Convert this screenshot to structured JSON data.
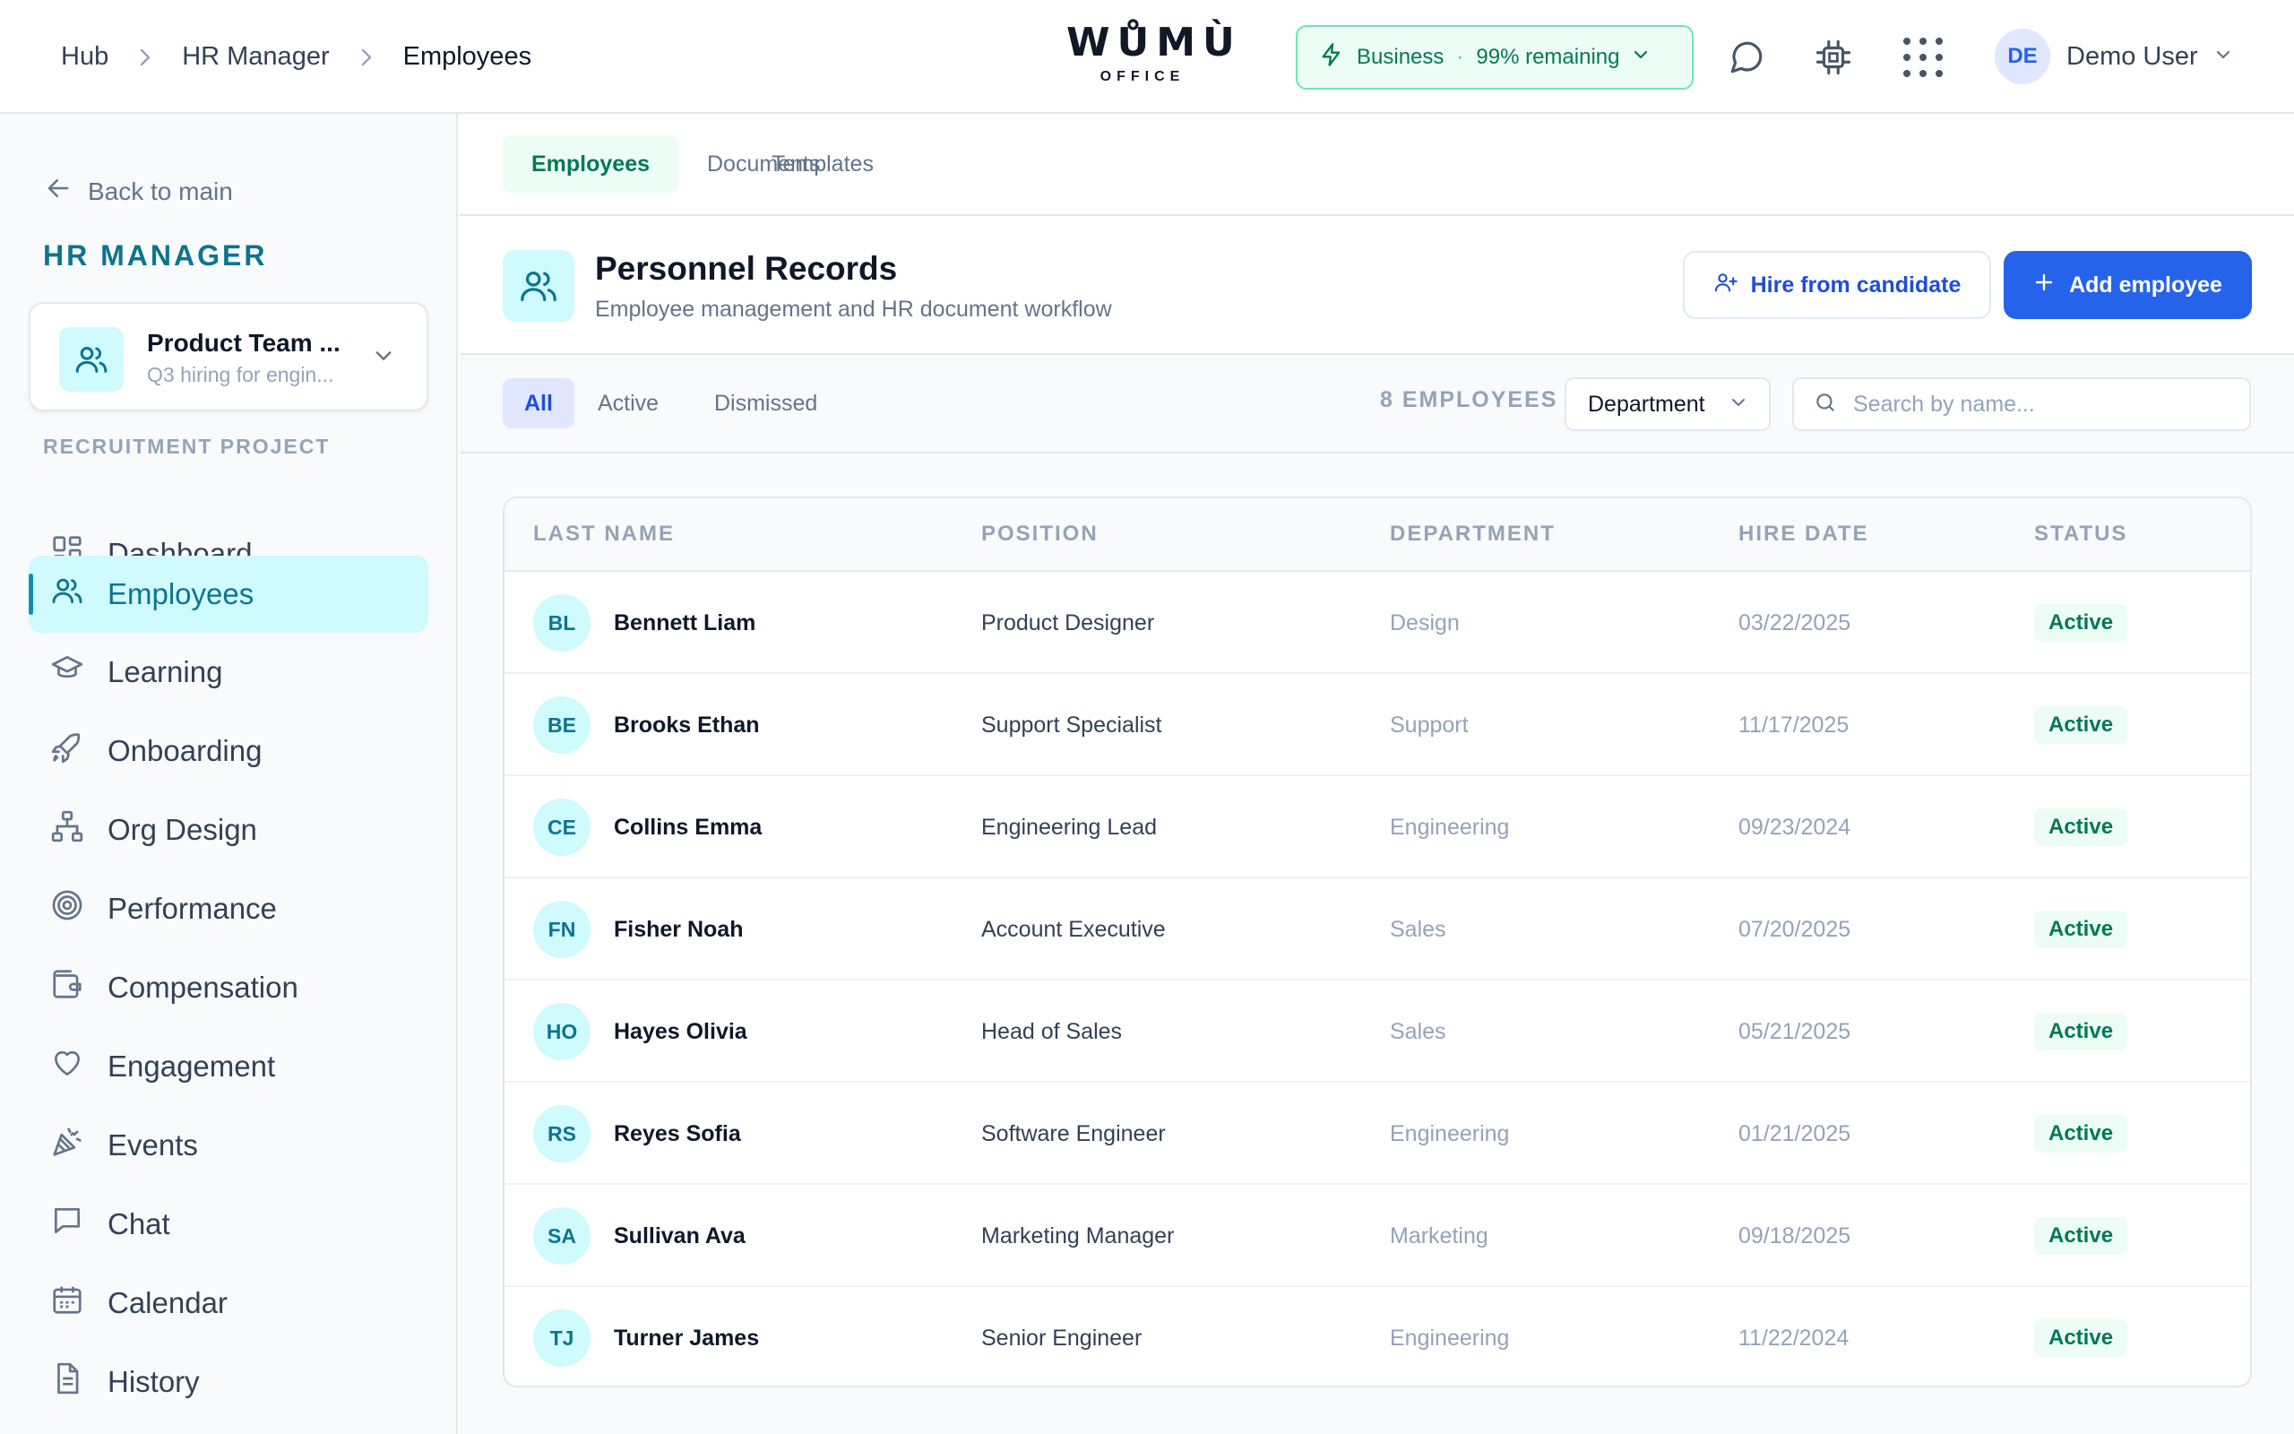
{
  "header": {
    "breadcrumb": [
      "Hub",
      "HR Manager",
      "Employees"
    ],
    "logo_mark": "WŮMÙ",
    "logo_sub": "OFFICE",
    "plan_name": "Business",
    "plan_dot": "·",
    "plan_remaining": "99% remaining",
    "user_initials": "DE",
    "user_name": "Demo User"
  },
  "sidebar": {
    "back_label": "Back to main",
    "title": "HR MANAGER",
    "project_name": "Product Team ...",
    "project_sub": "Q3 hiring for engin...",
    "section_label": "RECRUITMENT PROJECT",
    "items": [
      {
        "label": "Dashboard",
        "icon": "dashboard-icon"
      },
      {
        "label": "Employees",
        "icon": "users-icon",
        "active": true
      },
      {
        "label": "Learning",
        "icon": "graduation-cap-icon"
      },
      {
        "label": "Onboarding",
        "icon": "rocket-icon"
      },
      {
        "label": "Org Design",
        "icon": "org-chart-icon"
      },
      {
        "label": "Performance",
        "icon": "target-icon"
      },
      {
        "label": "Compensation",
        "icon": "wallet-icon"
      },
      {
        "label": "Engagement",
        "icon": "heart-icon"
      },
      {
        "label": "Events",
        "icon": "party-popper-icon"
      },
      {
        "label": "Chat",
        "icon": "chat-icon"
      },
      {
        "label": "Calendar",
        "icon": "calendar-icon"
      },
      {
        "label": "History",
        "icon": "document-icon"
      }
    ]
  },
  "tabs": [
    "Employees",
    "Documents",
    "Templates"
  ],
  "page": {
    "title": "Personnel Records",
    "subtitle": "Employee management and HR document workflow",
    "hire_button": "Hire from candidate",
    "add_button": "Add employee"
  },
  "filters": {
    "tabs": [
      "All",
      "Active",
      "Dismissed"
    ],
    "count": "8 EMPLOYEES",
    "department": "Department",
    "search_placeholder": "Search by name..."
  },
  "table": {
    "columns": [
      "LAST NAME",
      "POSITION",
      "DEPARTMENT",
      "HIRE DATE",
      "STATUS"
    ],
    "rows": [
      {
        "initials": "BL",
        "name": "Bennett Liam",
        "position": "Product Designer",
        "department": "Design",
        "hire_date": "03/22/2025",
        "status": "Active"
      },
      {
        "initials": "BE",
        "name": "Brooks Ethan",
        "position": "Support Specialist",
        "department": "Support",
        "hire_date": "11/17/2025",
        "status": "Active"
      },
      {
        "initials": "CE",
        "name": "Collins Emma",
        "position": "Engineering Lead",
        "department": "Engineering",
        "hire_date": "09/23/2024",
        "status": "Active"
      },
      {
        "initials": "FN",
        "name": "Fisher Noah",
        "position": "Account Executive",
        "department": "Sales",
        "hire_date": "07/20/2025",
        "status": "Active"
      },
      {
        "initials": "HO",
        "name": "Hayes Olivia",
        "position": "Head of Sales",
        "department": "Sales",
        "hire_date": "05/21/2025",
        "status": "Active"
      },
      {
        "initials": "RS",
        "name": "Reyes Sofia",
        "position": "Software Engineer",
        "department": "Engineering",
        "hire_date": "01/21/2025",
        "status": "Active"
      },
      {
        "initials": "SA",
        "name": "Sullivan Ava",
        "position": "Marketing Manager",
        "department": "Marketing",
        "hire_date": "09/18/2025",
        "status": "Active"
      },
      {
        "initials": "TJ",
        "name": "Turner James",
        "position": "Senior Engineer",
        "department": "Engineering",
        "hire_date": "11/22/2024",
        "status": "Active"
      }
    ]
  },
  "colors": {
    "accent": "#2563eb",
    "teal": "#0e7490",
    "success": "#047857"
  }
}
